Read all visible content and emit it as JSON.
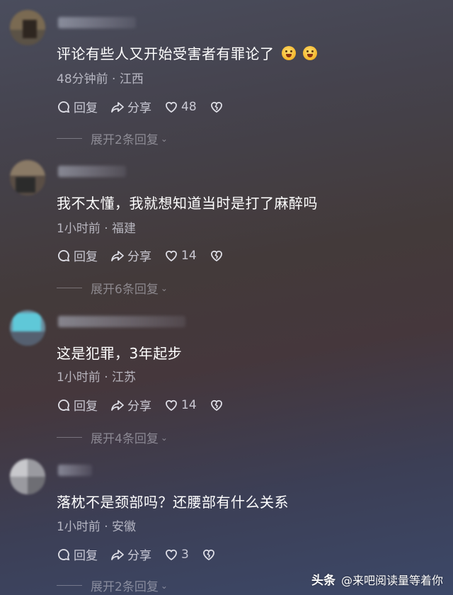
{
  "comments": [
    {
      "text": "评论有些人又开始受害者有罪论了",
      "emoji_count": 2,
      "meta": "48分钟前 · 江西",
      "reply": "回复",
      "share": "分享",
      "likes": "48",
      "expand": "展开2条回复"
    },
    {
      "text": "我不太懂，我就想知道当时是打了麻醉吗",
      "meta": "1小时前 · 福建",
      "reply": "回复",
      "share": "分享",
      "likes": "14",
      "expand": "展开6条回复"
    },
    {
      "text": "这是犯罪，3年起步",
      "meta": "1小时前 · 江苏",
      "reply": "回复",
      "share": "分享",
      "likes": "14",
      "expand": "展开4条回复"
    },
    {
      "text": "落枕不是颈部吗？还腰部有什么关系",
      "meta": "1小时前 · 安徽",
      "reply": "回复",
      "share": "分享",
      "likes": "3",
      "expand": "展开2条回复"
    }
  ],
  "watermark": {
    "brand": "头条",
    "handle": "@来吧阅读量等着你"
  },
  "icons": {
    "reply": "speech-bubble-icon",
    "share": "share-arrow-icon",
    "like": "heart-icon",
    "dislike": "broken-heart-icon",
    "expand": "chevron-down-icon"
  }
}
